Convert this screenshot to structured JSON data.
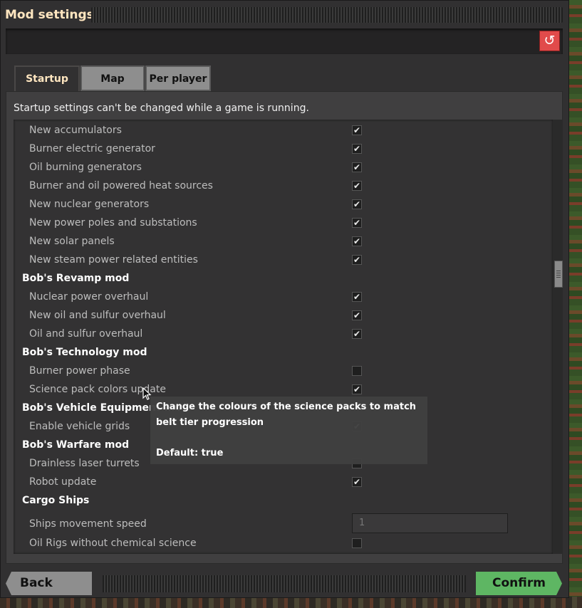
{
  "window": {
    "title": "Mod settings",
    "reset_icon": "↺"
  },
  "tabs": [
    {
      "label": "Startup",
      "active": true
    },
    {
      "label": "Map",
      "active": false
    },
    {
      "label": "Per player",
      "active": false
    }
  ],
  "notice": "Startup settings can't be changed while a game is running.",
  "settings": [
    {
      "type": "setting",
      "label": "New accumulators",
      "checked": true
    },
    {
      "type": "setting",
      "label": "Burner electric generator",
      "checked": true
    },
    {
      "type": "setting",
      "label": "Oil burning generators",
      "checked": true
    },
    {
      "type": "setting",
      "label": "Burner and oil powered heat sources",
      "checked": true
    },
    {
      "type": "setting",
      "label": "New nuclear generators",
      "checked": true
    },
    {
      "type": "setting",
      "label": "New power poles and substations",
      "checked": true
    },
    {
      "type": "setting",
      "label": "New solar panels",
      "checked": true
    },
    {
      "type": "setting",
      "label": "New steam power related entities",
      "checked": true
    },
    {
      "type": "section",
      "label": "Bob's Revamp mod"
    },
    {
      "type": "setting",
      "label": "Nuclear power overhaul",
      "checked": true
    },
    {
      "type": "setting",
      "label": "New oil and sulfur overhaul",
      "checked": true
    },
    {
      "type": "setting",
      "label": "Oil and sulfur overhaul",
      "checked": true
    },
    {
      "type": "section",
      "label": "Bob's Technology mod"
    },
    {
      "type": "setting",
      "label": "Burner power phase",
      "checked": false
    },
    {
      "type": "setting",
      "label": "Science pack colors update",
      "checked": true
    },
    {
      "type": "section",
      "label": "Bob's Vehicle Equipment mod"
    },
    {
      "type": "setting",
      "label": "Enable vehicle grids",
      "checked": true
    },
    {
      "type": "section",
      "label": "Bob's Warfare mod"
    },
    {
      "type": "setting",
      "label": "Drainless laser turrets",
      "checked": false
    },
    {
      "type": "setting",
      "label": "Robot update",
      "checked": true
    },
    {
      "type": "section",
      "label": "Cargo Ships"
    },
    {
      "type": "number",
      "label": "Ships movement speed",
      "value": "1"
    },
    {
      "type": "setting",
      "label": "Oil Rigs without chemical science",
      "checked": false
    }
  ],
  "tooltip": {
    "description": "Change the colours of the science packs to match belt tier progression",
    "default": "Default: true"
  },
  "footer": {
    "back_label": "Back",
    "confirm_label": "Confirm"
  },
  "colors": {
    "confirm": "#5eb663",
    "reset": "#e14b4b",
    "title": "#ffe6c0"
  }
}
